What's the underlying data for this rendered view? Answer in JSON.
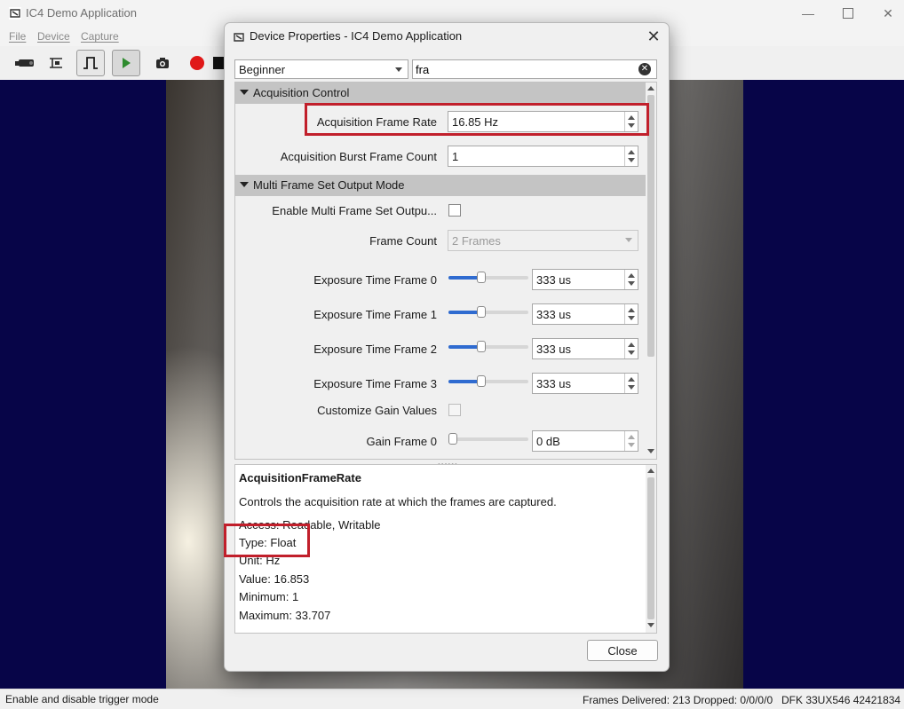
{
  "app": {
    "title": "IC4 Demo Application",
    "menu": [
      "File",
      "Device",
      "Capture"
    ],
    "status": {
      "left": "Enable and disable trigger mode",
      "frames": "Frames Delivered: 213 Dropped: 0/0/0/0",
      "device": "DFK 33UX546 42421834"
    }
  },
  "dialog": {
    "title": "Device Properties - IC4 Demo Application",
    "visibility": "Beginner",
    "search_value": "fra",
    "categories": [
      "Acquisition Control",
      "Multi Frame Set Output Mode"
    ],
    "properties": {
      "frame_rate": {
        "label": "Acquisition Frame Rate",
        "value": "16.85 Hz"
      },
      "burst": {
        "label": "Acquisition Burst Frame Count",
        "value": "1"
      },
      "mfs_enable": {
        "label": "Enable Multi Frame Set Outpu...",
        "checked": false
      },
      "frame_count": {
        "label": "Frame Count",
        "value": "2 Frames"
      },
      "exposure": [
        {
          "label": "Exposure Time Frame 0",
          "value": "333 us",
          "level": 0.4
        },
        {
          "label": "Exposure Time Frame 1",
          "value": "333 us",
          "level": 0.4
        },
        {
          "label": "Exposure Time Frame 2",
          "value": "333 us",
          "level": 0.4
        },
        {
          "label": "Exposure Time Frame 3",
          "value": "333 us",
          "level": 0.4
        }
      ],
      "custom_gain": {
        "label": "Customize Gain Values",
        "checked": false
      },
      "gain0": {
        "label": "Gain Frame 0",
        "value": "0 dB",
        "level": 0.0
      }
    },
    "info": {
      "name": "AcquisitionFrameRate",
      "description": "Controls the acquisition rate at which the frames are captured.",
      "access": "Access: Readable, Writable",
      "type": "Type: Float",
      "unit": "Unit: Hz",
      "value": "Value: 16.853",
      "minimum": "Minimum: 1",
      "maximum": "Maximum: 33.707"
    },
    "close_label": "Close"
  },
  "colors": {
    "highlight": "#c11f2b",
    "viewport_bg": "#070548",
    "slider_fill": "#2f6bd0"
  }
}
